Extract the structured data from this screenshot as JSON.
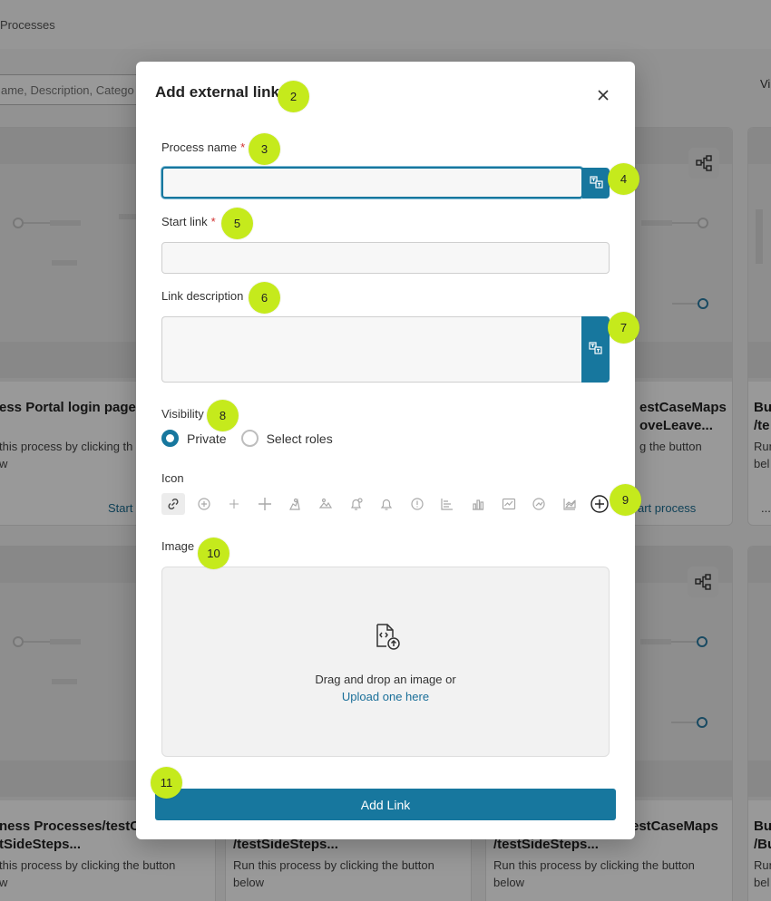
{
  "background": {
    "breadcrumb": "Processes",
    "search_placeholder": "ame, Description, Catego",
    "view_label": "Vi",
    "cards": [
      {
        "title1": "ess Portal login page",
        "title2": "",
        "desc": "this process by clicking th",
        "desc2": "w",
        "start": "Start"
      },
      {
        "title1": "estCaseMaps",
        "title2": "oveLeave...",
        "desc": "g the button",
        "desc2": "",
        "start": "art process"
      },
      {
        "title1": "Bu",
        "title2": "/te",
        "desc": "Run",
        "desc2": "bel",
        "start": "..."
      },
      {
        "title1": "ness Processes/testC",
        "title2": "tSideSteps...",
        "desc": "this process by clicking the button",
        "desc2": "w",
        "start": ""
      },
      {
        "title1": "",
        "title2": "/testSideSteps...",
        "desc": "Run this process by clicking the button",
        "desc2": "below",
        "start": ""
      },
      {
        "title1": "estCaseMaps",
        "title2": "/testSideSteps...",
        "desc": "Run this process by clicking the button",
        "desc2": "below",
        "start": ""
      },
      {
        "title1": "Bu",
        "title2": "/Bu",
        "desc": "Run",
        "desc2": "bel",
        "start": ""
      }
    ]
  },
  "modal": {
    "title": "Add external link",
    "close_icon": "close-icon",
    "process_name": {
      "label": "Process name",
      "required_mark": "*",
      "value": ""
    },
    "start_link": {
      "label": "Start link",
      "required_mark": "*",
      "value": ""
    },
    "link_description": {
      "label": "Link description",
      "value": ""
    },
    "translate_icon": "translate-icon",
    "visibility": {
      "label": "Visibility",
      "options": [
        "Private",
        "Select roles"
      ],
      "selected": "Private"
    },
    "icon_section": {
      "label": "Icon",
      "icons": [
        "link-icon",
        "plus-circle-icon",
        "plus-small-icon",
        "plus-icon",
        "puzzle-icon",
        "puzzle-outline-icon",
        "bell-alert-icon",
        "bell-icon",
        "exclamation-circle-icon",
        "bar-chart-horizontal-icon",
        "bar-chart-icon",
        "line-chart-icon",
        "gauge-icon",
        "area-chart-icon",
        "add-more-icon"
      ],
      "selected": "link-icon"
    },
    "image": {
      "label": "Image",
      "drop_text": "Drag and drop an image or",
      "upload_link": "Upload one here"
    },
    "submit_label": "Add Link"
  },
  "markers": [
    "2",
    "3",
    "4",
    "5",
    "6",
    "7",
    "8",
    "9",
    "10",
    "11"
  ],
  "colors": {
    "accent": "#17779e",
    "marker": "#c5ea1c",
    "required": "#d12f2f"
  }
}
